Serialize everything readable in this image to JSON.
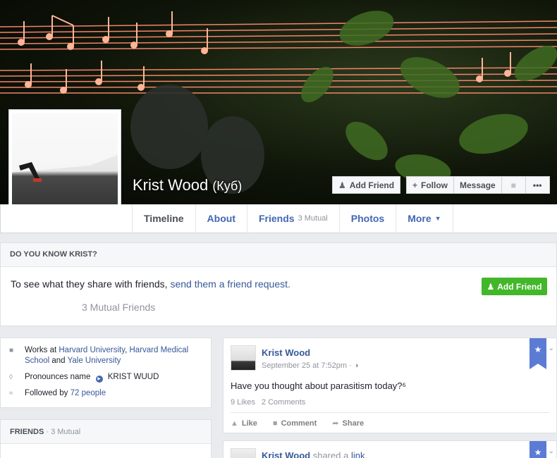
{
  "colors": {
    "link": "#365899",
    "tab": "#4267b2",
    "green": "#42b72a",
    "ribbon": "#5b7bd5"
  },
  "profile": {
    "name": "Krist Wood",
    "alt_name": "(Куб)"
  },
  "cover_buttons": {
    "add_friend": "Add Friend",
    "follow": "Follow",
    "message": "Message",
    "video_icon": "video-icon",
    "more_icon": "•••"
  },
  "tabs": [
    {
      "label": "Timeline"
    },
    {
      "label": "About"
    },
    {
      "label": "Friends",
      "sub": "3 Mutual"
    },
    {
      "label": "Photos"
    },
    {
      "label": "More"
    }
  ],
  "know": {
    "header": "DO YOU KNOW KRIST?",
    "text": "To see what they share with friends,",
    "link": "send them a friend request.",
    "mutual": "3 Mutual Friends",
    "button": "Add Friend"
  },
  "intro": {
    "works_prefix": "Works at",
    "work1": "Harvard University",
    "work2": "Harvard Medical School",
    "and": "and",
    "work3": "Yale University",
    "pronounce_label": "Pronounces name",
    "pronounce_value": "KRIST WUUD",
    "followed_prefix": "Followed by",
    "followed_link": "72 people"
  },
  "friends_box": {
    "title": "FRIENDS",
    "sub": "· 3 Mutual"
  },
  "post1": {
    "author": "Krist Wood",
    "date": "September 25 at 7:52pm · ",
    "text": "Have you thought about parasitism today?⁶",
    "likes": "9 Likes",
    "comments": "2 Comments",
    "like": "Like",
    "comment": "Comment",
    "share": "Share"
  },
  "post2": {
    "author": "Krist Wood",
    "shared": "shared a",
    "link": "link."
  }
}
